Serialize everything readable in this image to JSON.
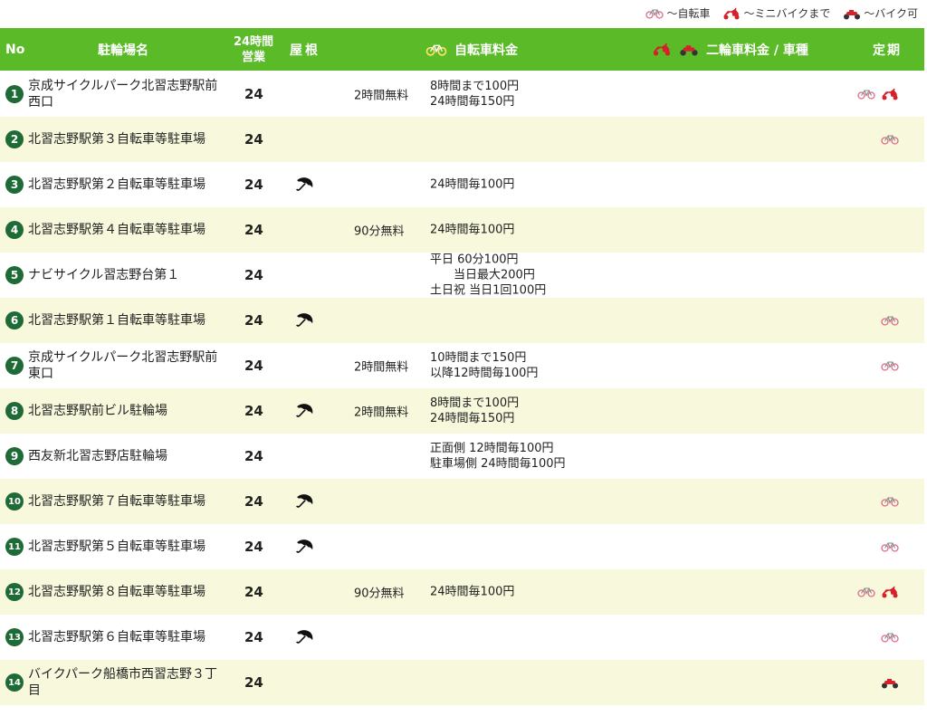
{
  "legend": {
    "bicycle": "～自転車",
    "mini": "～ミニバイクまで",
    "moto": "～バイク可"
  },
  "header": {
    "no": "No",
    "name": "駐輪場名",
    "h24_line1": "24時間",
    "h24_line2": "営業",
    "roof": "屋根",
    "bike_fee": "自転車料金",
    "moto_fee": "二輪車料金 / 車種",
    "teiki": "定期"
  },
  "colors": {
    "header_bg": "#5bba27",
    "num_bg": "#1f6b37",
    "alt_row": "#f7f8dc",
    "icon_red": "#d6202a"
  },
  "rows": [
    {
      "no": "1",
      "name": "京成サイクルパーク北習志野駅前西口",
      "h24": "24",
      "roof": false,
      "free": "2時間無料",
      "fee": "8時間まで100円\n24時間毎150円",
      "teiki": [
        "bicycle",
        "mini"
      ]
    },
    {
      "no": "2",
      "name": "北習志野駅第３自転車等駐車場",
      "h24": "24",
      "roof": false,
      "free": "",
      "fee": "",
      "teiki": [
        "bicycle"
      ]
    },
    {
      "no": "3",
      "name": "北習志野駅第２自転車等駐車場",
      "h24": "24",
      "roof": true,
      "free": "",
      "fee": "24時間毎100円",
      "teiki": []
    },
    {
      "no": "4",
      "name": "北習志野駅第４自転車等駐車場",
      "h24": "24",
      "roof": false,
      "free": "90分無料",
      "fee": "24時間毎100円",
      "teiki": []
    },
    {
      "no": "5",
      "name": "ナビサイクル習志野台第１",
      "h24": "24",
      "roof": false,
      "free": "",
      "fee": "平日 60分100円\n　　当日最大200円\n土日祝 当日1回100円",
      "teiki": []
    },
    {
      "no": "6",
      "name": "北習志野駅第１自転車等駐車場",
      "h24": "24",
      "roof": true,
      "free": "",
      "fee": "",
      "teiki": [
        "bicycle"
      ]
    },
    {
      "no": "7",
      "name": "京成サイクルパーク北習志野駅前東口",
      "h24": "24",
      "roof": false,
      "free": "2時間無料",
      "fee": "10時間まで150円\n以降12時間毎100円",
      "teiki": [
        "bicycle"
      ]
    },
    {
      "no": "8",
      "name": "北習志野駅前ビル駐輪場",
      "h24": "24",
      "roof": true,
      "free": "2時間無料",
      "fee": "8時間まで100円\n24時間毎150円",
      "teiki": []
    },
    {
      "no": "9",
      "name": "西友新北習志野店駐輪場",
      "h24": "24",
      "roof": false,
      "free": "",
      "fee": "正面側 12時間毎100円\n駐車場側 24時間毎100円",
      "teiki": []
    },
    {
      "no": "10",
      "name": "北習志野駅第７自転車等駐車場",
      "h24": "24",
      "roof": true,
      "free": "",
      "fee": "",
      "teiki": [
        "bicycle"
      ]
    },
    {
      "no": "11",
      "name": "北習志野駅第５自転車等駐車場",
      "h24": "24",
      "roof": true,
      "free": "",
      "fee": "",
      "teiki": [
        "bicycle"
      ]
    },
    {
      "no": "12",
      "name": "北習志野駅第８自転車等駐車場",
      "h24": "24",
      "roof": false,
      "free": "90分無料",
      "fee": "24時間毎100円",
      "teiki": [
        "bicycle",
        "mini"
      ]
    },
    {
      "no": "13",
      "name": "北習志野駅第６自転車等駐車場",
      "h24": "24",
      "roof": true,
      "free": "",
      "fee": "",
      "teiki": [
        "bicycle"
      ]
    },
    {
      "no": "14",
      "name": "バイクパーク船橋市西習志野３丁目",
      "h24": "24",
      "roof": false,
      "free": "",
      "fee": "",
      "teiki": [
        "moto"
      ]
    }
  ]
}
